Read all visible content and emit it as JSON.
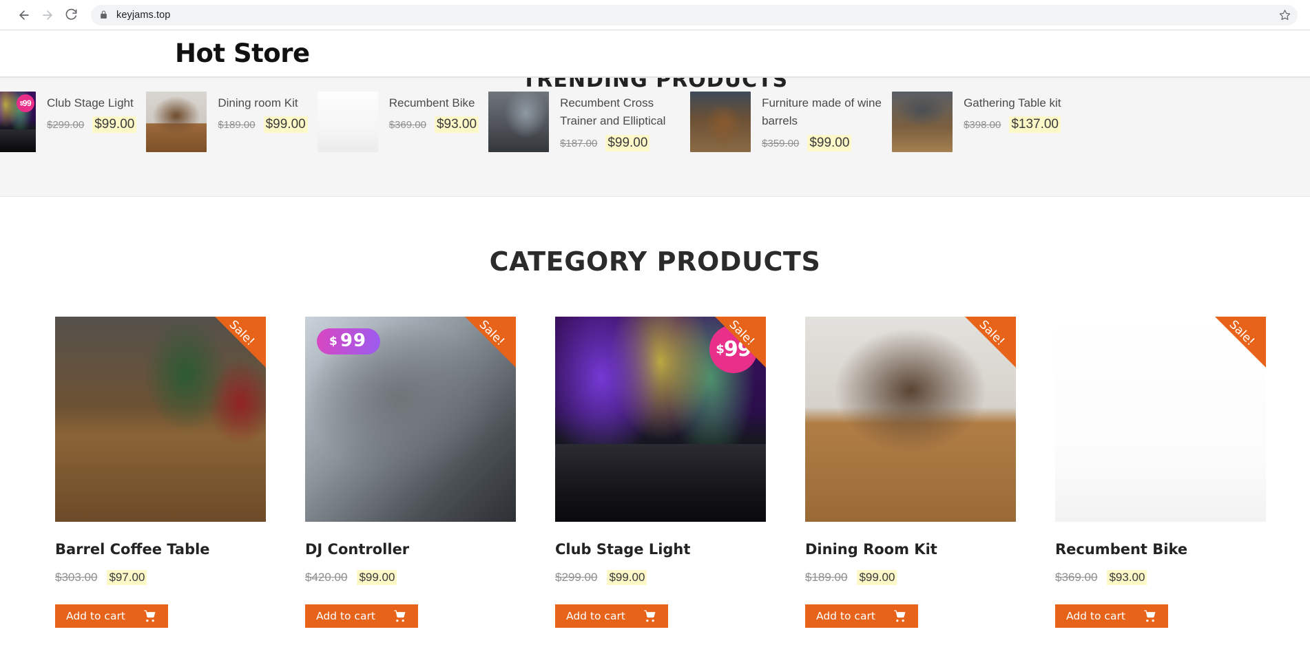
{
  "browser": {
    "back_label": "Back",
    "forward_label": "Forward",
    "reload_label": "Reload",
    "url": "keyjams.top",
    "lock_icon": "lock-icon",
    "star_icon": "bookmark-star-icon"
  },
  "header": {
    "logo": "Hot Store"
  },
  "trending": {
    "heading": "TRENDING PRODUCTS",
    "items": [
      {
        "title": "Club Stage Light",
        "old_price": "$299.00",
        "new_price": "$99.00",
        "badge": "99",
        "badge_currency": "$",
        "photo": "ph-stage"
      },
      {
        "title": "Dining room Kit",
        "old_price": "$189.00",
        "new_price": "$99.00",
        "badge": "",
        "badge_currency": "",
        "photo": "ph-dining"
      },
      {
        "title": "Recumbent Bike",
        "old_price": "$369.00",
        "new_price": "$93.00",
        "badge": "",
        "badge_currency": "",
        "photo": "ph-bike"
      },
      {
        "title": "Recumbent Cross Trainer and Elliptical",
        "old_price": "$187.00",
        "new_price": "$99.00",
        "badge": "",
        "badge_currency": "",
        "photo": "ph-elliptical"
      },
      {
        "title": "Furniture made of wine barrels",
        "old_price": "$359.00",
        "new_price": "$99.00",
        "badge": "",
        "badge_currency": "",
        "photo": "ph-barrelfurn"
      },
      {
        "title": "Gathering Table kit",
        "old_price": "$398.00",
        "new_price": "$137.00",
        "badge": "",
        "badge_currency": "",
        "photo": "ph-gathering"
      }
    ]
  },
  "category": {
    "heading": "CATEGORY PRODUCTS",
    "sale_ribbon_label": "Sale!",
    "add_to_cart_label": "Add to cart",
    "cart_icon": "shopping-cart-icon",
    "products": [
      {
        "title": "Barrel Coffee Table",
        "old_price": "$303.00",
        "new_price": "$97.00",
        "photo": "ph-coffeetable",
        "pill_badge": "",
        "pill_currency": "",
        "circle_badge": "",
        "circle_currency": ""
      },
      {
        "title": "DJ Controller",
        "old_price": "$420.00",
        "new_price": "$99.00",
        "photo": "ph-dj",
        "pill_badge": "99",
        "pill_currency": "$",
        "circle_badge": "",
        "circle_currency": ""
      },
      {
        "title": "Club Stage Light",
        "old_price": "$299.00",
        "new_price": "$99.00",
        "photo": "ph-stage",
        "pill_badge": "",
        "pill_currency": "",
        "circle_badge": "99",
        "circle_currency": "$"
      },
      {
        "title": "Dining Room Kit",
        "old_price": "$189.00",
        "new_price": "$99.00",
        "photo": "ph-diningroom",
        "pill_badge": "",
        "pill_currency": "",
        "circle_badge": "",
        "circle_currency": ""
      },
      {
        "title": "Recumbent Bike",
        "old_price": "$369.00",
        "new_price": "$93.00",
        "photo": "ph-recumbent",
        "pill_badge": "",
        "pill_currency": "",
        "circle_badge": "",
        "circle_currency": ""
      }
    ]
  },
  "colors": {
    "accent_orange": "#e8631a",
    "badge_pink": "#e8308a",
    "price_highlight": "#fdf8c8",
    "trending_bg": "#f5f5f5"
  }
}
